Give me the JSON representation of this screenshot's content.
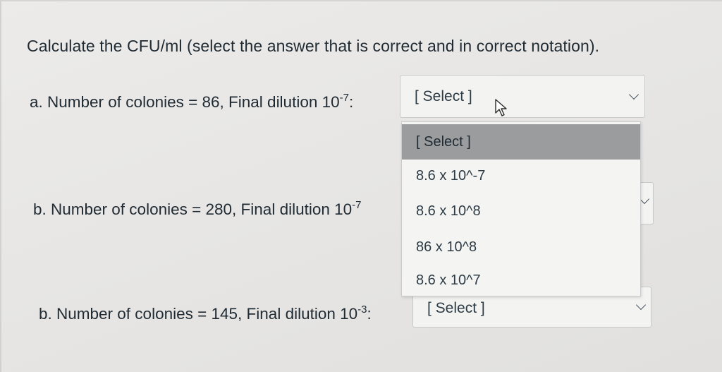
{
  "question": {
    "prompt": "Calculate the CFU/ml (select the answer that is correct and in correct notation)."
  },
  "rows": [
    {
      "label_prefix": "a. Number of colonies = 86, Final dilution 10",
      "exponent": "-7",
      "label_suffix": ":",
      "select_value": "[ Select ]"
    },
    {
      "label_prefix": "b. Number of colonies = 280, Final dilution 10",
      "exponent": "-7",
      "label_suffix": ""
    },
    {
      "label_prefix": "b. Number of colonies = 145, Final dilution 10",
      "exponent": "-3",
      "label_suffix": ":",
      "select_value": "[ Select ]"
    }
  ],
  "dropdown": {
    "options": [
      "[ Select ]",
      "8.6 x 10^-7",
      "8.6 x 10^8",
      "86 x 10^8",
      "8.6 x 10^7"
    ],
    "highlighted_index": 0
  },
  "icons": {
    "chevron": "chevron-down-icon",
    "cursor": "mouse-pointer-icon"
  }
}
